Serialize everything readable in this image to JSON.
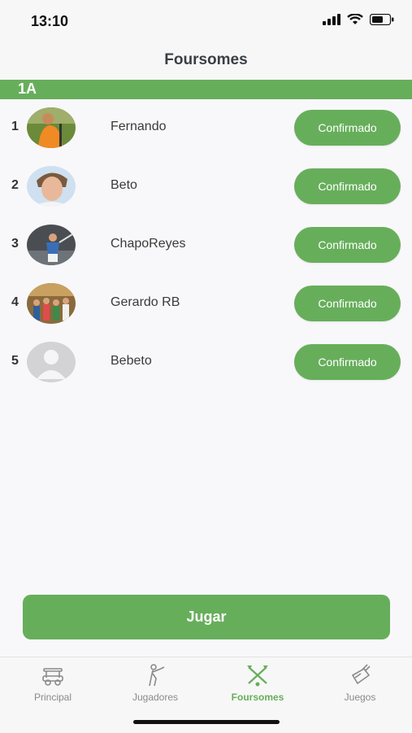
{
  "status_bar": {
    "time": "13:10"
  },
  "nav": {
    "title": "Foursomes"
  },
  "group": {
    "label": "1A"
  },
  "players": [
    {
      "number": "1",
      "name": "Fernando",
      "status": "Confirmado"
    },
    {
      "number": "2",
      "name": "Beto",
      "status": "Confirmado"
    },
    {
      "number": "3",
      "name": "ChapoReyes",
      "status": "Confirmado"
    },
    {
      "number": "4",
      "name": "Gerardo RB",
      "status": "Confirmado"
    },
    {
      "number": "5",
      "name": "Bebeto",
      "status": "Confirmado"
    }
  ],
  "play_button": {
    "label": "Jugar"
  },
  "tabs": [
    {
      "label": "Principal",
      "icon": "golf-cart-icon",
      "active": false
    },
    {
      "label": "Jugadores",
      "icon": "golfer-icon",
      "active": false
    },
    {
      "label": "Foursomes",
      "icon": "crossed-clubs-icon",
      "active": true
    },
    {
      "label": "Juegos",
      "icon": "golf-bag-icon",
      "active": false
    }
  ],
  "colors": {
    "accent": "#67ae5b",
    "background": "#f8f8fa",
    "inactive": "#8a8a8a"
  }
}
